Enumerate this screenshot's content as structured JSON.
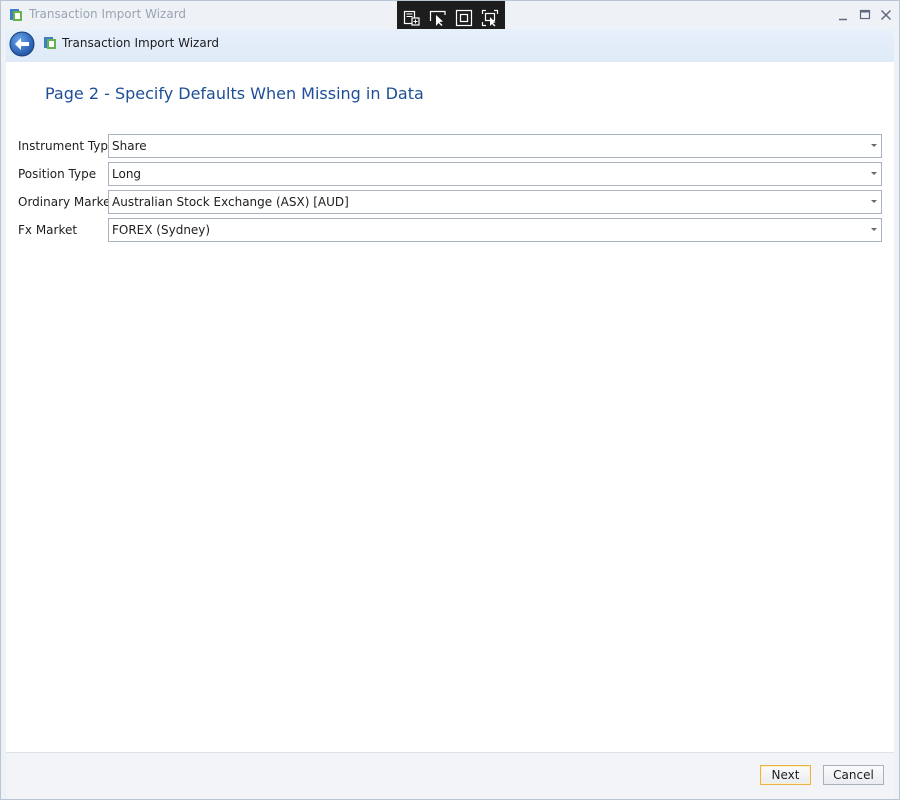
{
  "window": {
    "title": "Transaction Import Wizard"
  },
  "nav": {
    "title": "Transaction Import Wizard"
  },
  "page": {
    "heading": "Page 2 - Specify Defaults When Missing in Data"
  },
  "fields": [
    {
      "label": "Instrument Type",
      "value": "Share"
    },
    {
      "label": "Position Type",
      "value": "Long"
    },
    {
      "label": "Ordinary Market",
      "value": "Australian Stock Exchange (ASX) [AUD]"
    },
    {
      "label": "Fx Market",
      "value": "FOREX (Sydney)"
    }
  ],
  "buttons": {
    "next": "Next",
    "cancel": "Cancel"
  },
  "colors": {
    "accent_blue": "#1e4e97",
    "default_button_border": "#e8b247",
    "debug_toolbar": "#1d1d1d"
  },
  "icons": {
    "app": "app-logo-icon",
    "back": "back-arrow-icon",
    "minimize": "minimize-icon",
    "maximize": "maximize-icon",
    "close": "close-icon",
    "debug_tools": [
      "select-element-icon",
      "pointer-select-icon",
      "layout-adorner-icon",
      "track-focus-icon"
    ]
  }
}
